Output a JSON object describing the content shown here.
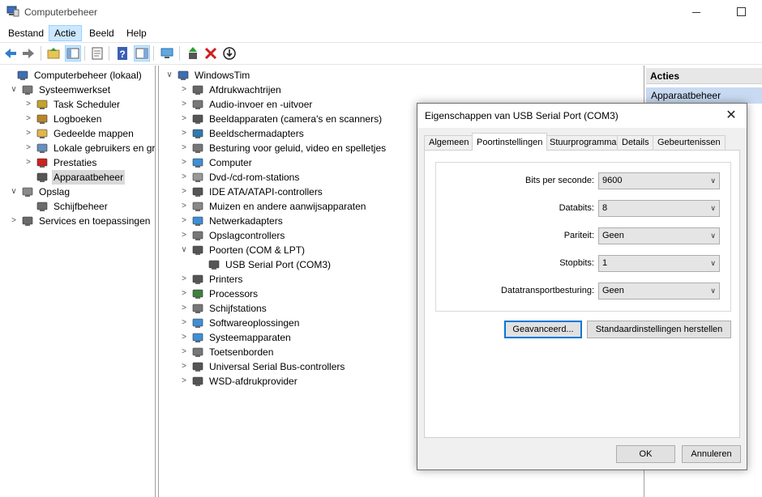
{
  "window": {
    "title": "Computerbeheer"
  },
  "menu": [
    "Bestand",
    "Actie",
    "Beeld",
    "Help"
  ],
  "left_tree": [
    {
      "label": "Computerbeheer (lokaal)",
      "icon": "computer-management-icon",
      "expander": ""
    },
    {
      "label": "Systeemwerkset",
      "icon": "tools-icon",
      "expander": "∨"
    },
    {
      "label": "Task Scheduler",
      "icon": "clock-icon",
      "expander": ">"
    },
    {
      "label": "Logboeken",
      "icon": "event-log-icon",
      "expander": ">"
    },
    {
      "label": "Gedeelde mappen",
      "icon": "shared-folder-icon",
      "expander": ">"
    },
    {
      "label": "Lokale gebruikers en gro",
      "icon": "users-icon",
      "expander": ">"
    },
    {
      "label": "Prestaties",
      "icon": "performance-icon",
      "expander": ">"
    },
    {
      "label": "Apparaatbeheer",
      "icon": "device-manager-icon",
      "expander": ""
    },
    {
      "label": "Opslag",
      "icon": "storage-icon",
      "expander": "∨"
    },
    {
      "label": "Schijfbeheer",
      "icon": "disk-icon",
      "expander": ""
    },
    {
      "label": "Services en toepassingen",
      "icon": "services-icon",
      "expander": ">"
    }
  ],
  "device_tree": {
    "root": "WindowsTim",
    "categories": [
      {
        "label": "Afdrukwachtrijen",
        "icon": "print-queue-icon",
        "expander": ">"
      },
      {
        "label": "Audio-invoer en -uitvoer",
        "icon": "speaker-icon",
        "expander": ">"
      },
      {
        "label": "Beeldapparaten (camera's en scanners)",
        "icon": "camera-icon",
        "expander": ">"
      },
      {
        "label": "Beeldschermadapters",
        "icon": "display-adapter-icon",
        "expander": ">"
      },
      {
        "label": "Besturing voor geluid, video en spelletjes",
        "icon": "sound-icon",
        "expander": ">"
      },
      {
        "label": "Computer",
        "icon": "monitor-icon",
        "expander": ">"
      },
      {
        "label": "Dvd-/cd-rom-stations",
        "icon": "dvd-icon",
        "expander": ">"
      },
      {
        "label": "IDE ATA/ATAPI-controllers",
        "icon": "ide-icon",
        "expander": ">"
      },
      {
        "label": "Muizen en andere aanwijsapparaten",
        "icon": "mouse-icon",
        "expander": ">"
      },
      {
        "label": "Netwerkadapters",
        "icon": "network-icon",
        "expander": ">"
      },
      {
        "label": "Opslagcontrollers",
        "icon": "storage-controller-icon",
        "expander": ">"
      },
      {
        "label": "Poorten (COM & LPT)",
        "icon": "port-icon",
        "expander": "∨"
      },
      {
        "label": "USB Serial Port (COM3)",
        "icon": "port-icon",
        "expander": ""
      },
      {
        "label": "Printers",
        "icon": "printer-icon",
        "expander": ">"
      },
      {
        "label": "Processors",
        "icon": "cpu-icon",
        "expander": ">"
      },
      {
        "label": "Schijfstations",
        "icon": "drive-icon",
        "expander": ">"
      },
      {
        "label": "Softwareoplossingen",
        "icon": "software-icon",
        "expander": ">"
      },
      {
        "label": "Systeemapparaten",
        "icon": "system-device-icon",
        "expander": ">"
      },
      {
        "label": "Toetsenborden",
        "icon": "keyboard-icon",
        "expander": ">"
      },
      {
        "label": "Universal Serial Bus-controllers",
        "icon": "usb-icon",
        "expander": ">"
      },
      {
        "label": "WSD-afdrukprovider",
        "icon": "wsd-printer-icon",
        "expander": ">"
      }
    ]
  },
  "actions_pane": {
    "header": "Acties",
    "item": "Apparaatbeheer"
  },
  "dialog": {
    "title": "Eigenschappen van USB Serial Port (COM3)",
    "tabs": [
      "Algemeen",
      "Poortinstellingen",
      "Stuurprogramma",
      "Details",
      "Gebeurtenissen"
    ],
    "active_tab": "Poortinstellingen",
    "fields": [
      {
        "label": "Bits per seconde:",
        "value": "9600"
      },
      {
        "label": "Databits:",
        "value": "8"
      },
      {
        "label": "Pariteit:",
        "value": "Geen"
      },
      {
        "label": "Stopbits:",
        "value": "1"
      },
      {
        "label": "Datatransportbesturing:",
        "value": "Geen"
      }
    ],
    "advanced_button": "Geavanceerd...",
    "defaults_button": "Standaardinstellingen herstellen",
    "ok_button": "OK",
    "cancel_button": "Annuleren"
  },
  "colors": {
    "selection": "#cce8ff",
    "tree_selected": "#d9d9d9",
    "actions_highlight": "#c8daf2",
    "dialog_bg": "#f0f0f0",
    "focus_border": "#0078d7"
  }
}
